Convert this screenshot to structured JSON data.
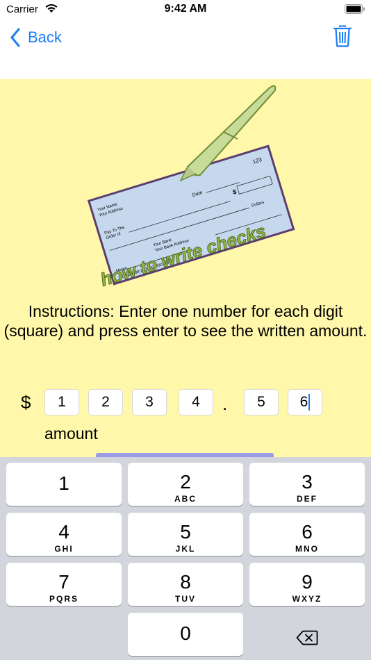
{
  "status": {
    "carrier": "Carrier",
    "time": "9:42 AM"
  },
  "nav": {
    "back_label": "Back"
  },
  "check": {
    "number": "123",
    "date_label": "Date",
    "dollar_sign": "$",
    "name": "Your Name",
    "address": "Your Address",
    "pay_to": "Pay To The",
    "order_of": "Order of",
    "dollars_label": "Dollars",
    "bank": "Your Bank",
    "bank_address": "Your Bank Address",
    "memo": "Memo",
    "micr": ":123456789:1234567890123"
  },
  "logo_text": "how to write checks",
  "instructions": "Instructions: Enter one number for each digit (square) and press enter to see the written amount.",
  "amount_entry": {
    "currency": "$",
    "digits": [
      "1",
      "2",
      "3",
      "4",
      "5",
      "6"
    ],
    "separator": ".",
    "label": "amount"
  },
  "keyboard": {
    "keys": [
      {
        "num": "1",
        "letters": ""
      },
      {
        "num": "2",
        "letters": "ABC"
      },
      {
        "num": "3",
        "letters": "DEF"
      },
      {
        "num": "4",
        "letters": "GHI"
      },
      {
        "num": "5",
        "letters": "JKL"
      },
      {
        "num": "6",
        "letters": "MNO"
      },
      {
        "num": "7",
        "letters": "PQRS"
      },
      {
        "num": "8",
        "letters": "TUV"
      },
      {
        "num": "9",
        "letters": "WXYZ"
      },
      {
        "num": "0",
        "letters": ""
      }
    ]
  },
  "colors": {
    "accent": "#1a7cf5",
    "background": "#fff7a9",
    "check": "#c5d8ee",
    "pen": "#c8dc9a"
  },
  "icons": {
    "back": "chevron-left-icon",
    "trash": "trash-icon",
    "delete": "delete-backward-icon",
    "wifi": "wifi-icon",
    "battery": "battery-icon"
  }
}
